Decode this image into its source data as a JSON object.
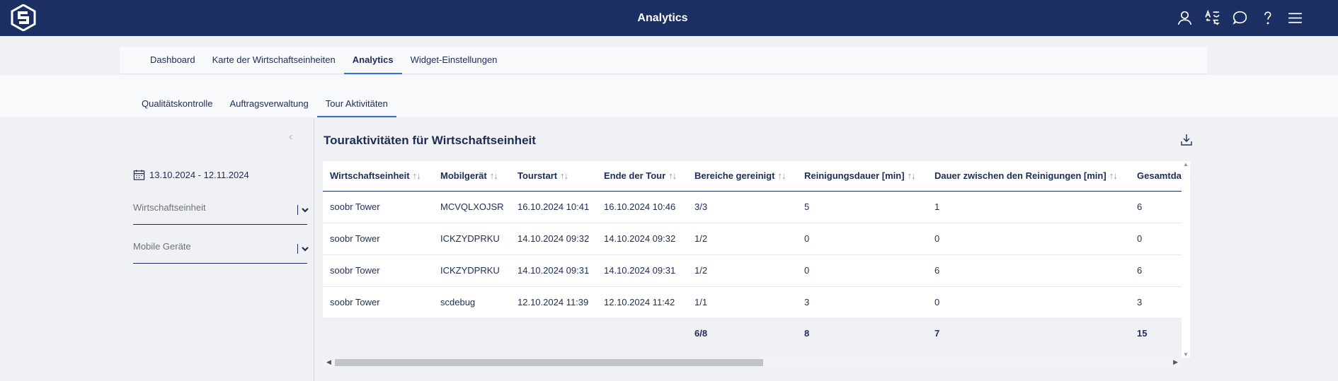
{
  "app": {
    "title": "Analytics",
    "brand_color": "#1b2f62",
    "accent_color": "#2d6ee0"
  },
  "top_icons": [
    "user-icon",
    "translate-icon",
    "chat-icon",
    "help-icon",
    "menu-icon"
  ],
  "primary_tabs": [
    {
      "label": "Dashboard",
      "active": false
    },
    {
      "label": "Karte der Wirtschaftseinheiten",
      "active": false
    },
    {
      "label": "Analytics",
      "active": true
    },
    {
      "label": "Widget-Einstellungen",
      "active": false
    }
  ],
  "sub_tabs": [
    {
      "label": "Qualitätskontrolle",
      "active": false
    },
    {
      "label": "Auftragsverwaltung",
      "active": false
    },
    {
      "label": "Tour Aktivitäten",
      "active": true
    }
  ],
  "filters": {
    "date_range": "13.10.2024 - 12.11.2024",
    "unit_placeholder": "Wirtschaftseinheit",
    "device_placeholder": "Mobile Geräte"
  },
  "panel": {
    "title": "Touraktivitäten für Wirtschaftseinheit"
  },
  "table": {
    "sort_glyph": "↑↓",
    "headers": [
      "Wirtschaftseinheit",
      "Mobilgerät",
      "Tourstart",
      "Ende der Tour",
      "Bereiche gereinigt",
      "Reinigungsdauer [min]",
      "Dauer zwischen den Reinigungen [min]",
      "Gesamtda"
    ],
    "rows": [
      [
        "soobr Tower",
        "MCVQLXOJSR",
        "16.10.2024 10:41",
        "16.10.2024 10:46",
        "3/3",
        "5",
        "1",
        "6"
      ],
      [
        "soobr Tower",
        "ICKZYDPRKU",
        "14.10.2024 09:32",
        "14.10.2024 09:32",
        "1/2",
        "0",
        "0",
        "0"
      ],
      [
        "soobr Tower",
        "ICKZYDPRKU",
        "14.10.2024 09:31",
        "14.10.2024 09:31",
        "1/2",
        "0",
        "6",
        "6"
      ],
      [
        "soobr Tower",
        "scdebug",
        "12.10.2024 11:39",
        "12.10.2024 11:42",
        "1/1",
        "3",
        "0",
        "3"
      ]
    ],
    "summary": [
      "",
      "",
      "",
      "",
      "6/8",
      "8",
      "7",
      "15"
    ]
  }
}
